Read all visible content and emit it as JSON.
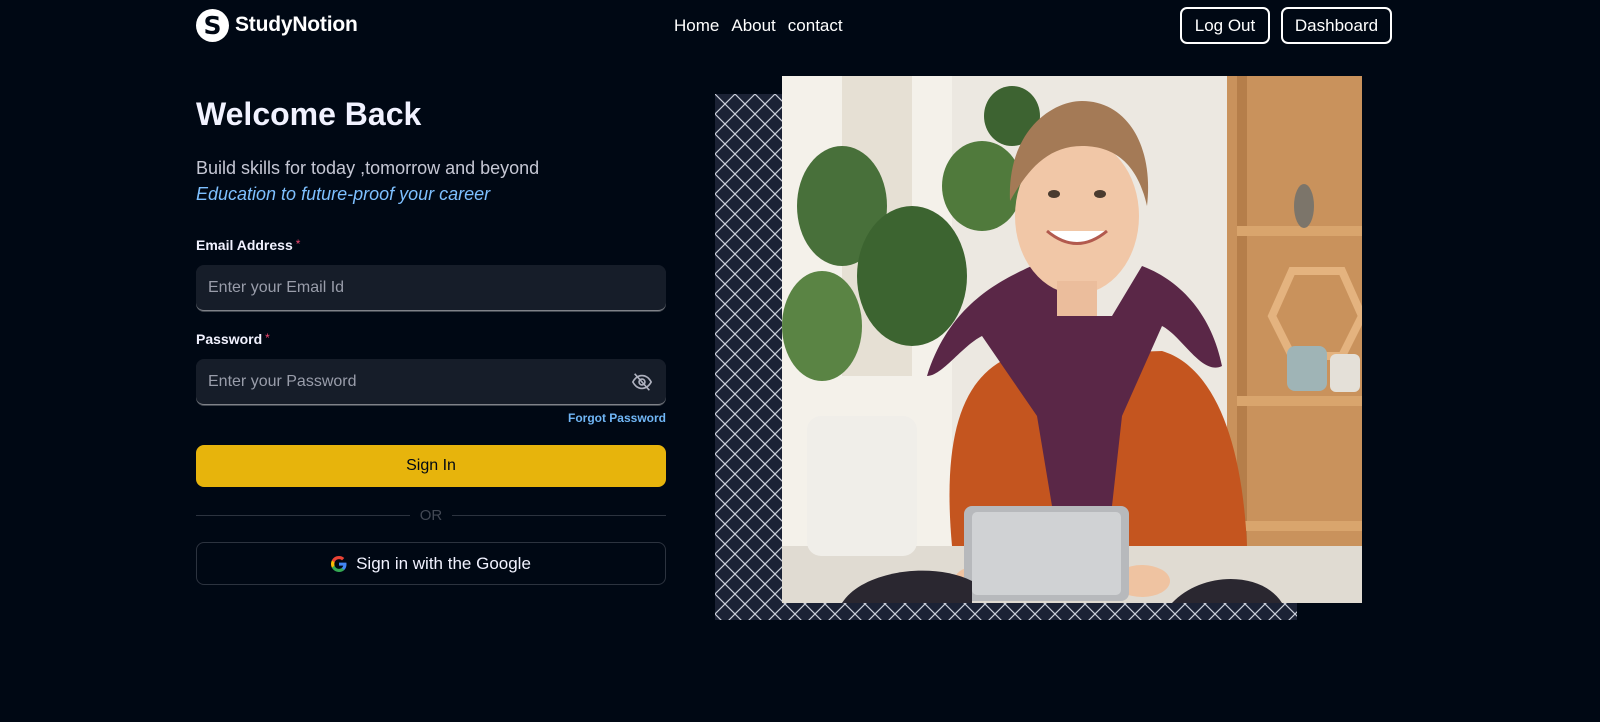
{
  "brand": {
    "name": "StudyNotion",
    "mark": "S"
  },
  "nav": {
    "items": [
      "Home",
      "About",
      "contact"
    ]
  },
  "auth": {
    "logout": "Log Out",
    "dashboard": "Dashboard"
  },
  "form": {
    "title": "Welcome Back",
    "subtitle": "Build skills for today ,tomorrow and beyond",
    "tagline": "Education to future-proof your career",
    "email_label": "Email Address",
    "email_placeholder": "Enter your Email Id",
    "password_label": "Password",
    "password_placeholder": "Enter your Password",
    "required_mark": "*",
    "forgot": "Forgot Password",
    "signin": "Sign In",
    "or": "OR",
    "google": "Sign in with the Google"
  },
  "colors": {
    "background": "#000814",
    "accent": "#e7b40c",
    "link": "#70b6f5",
    "required": "#ef476f"
  },
  "icons": {
    "password_toggle": "eye-off-icon",
    "google": "google-icon",
    "logo": "logo-icon"
  }
}
